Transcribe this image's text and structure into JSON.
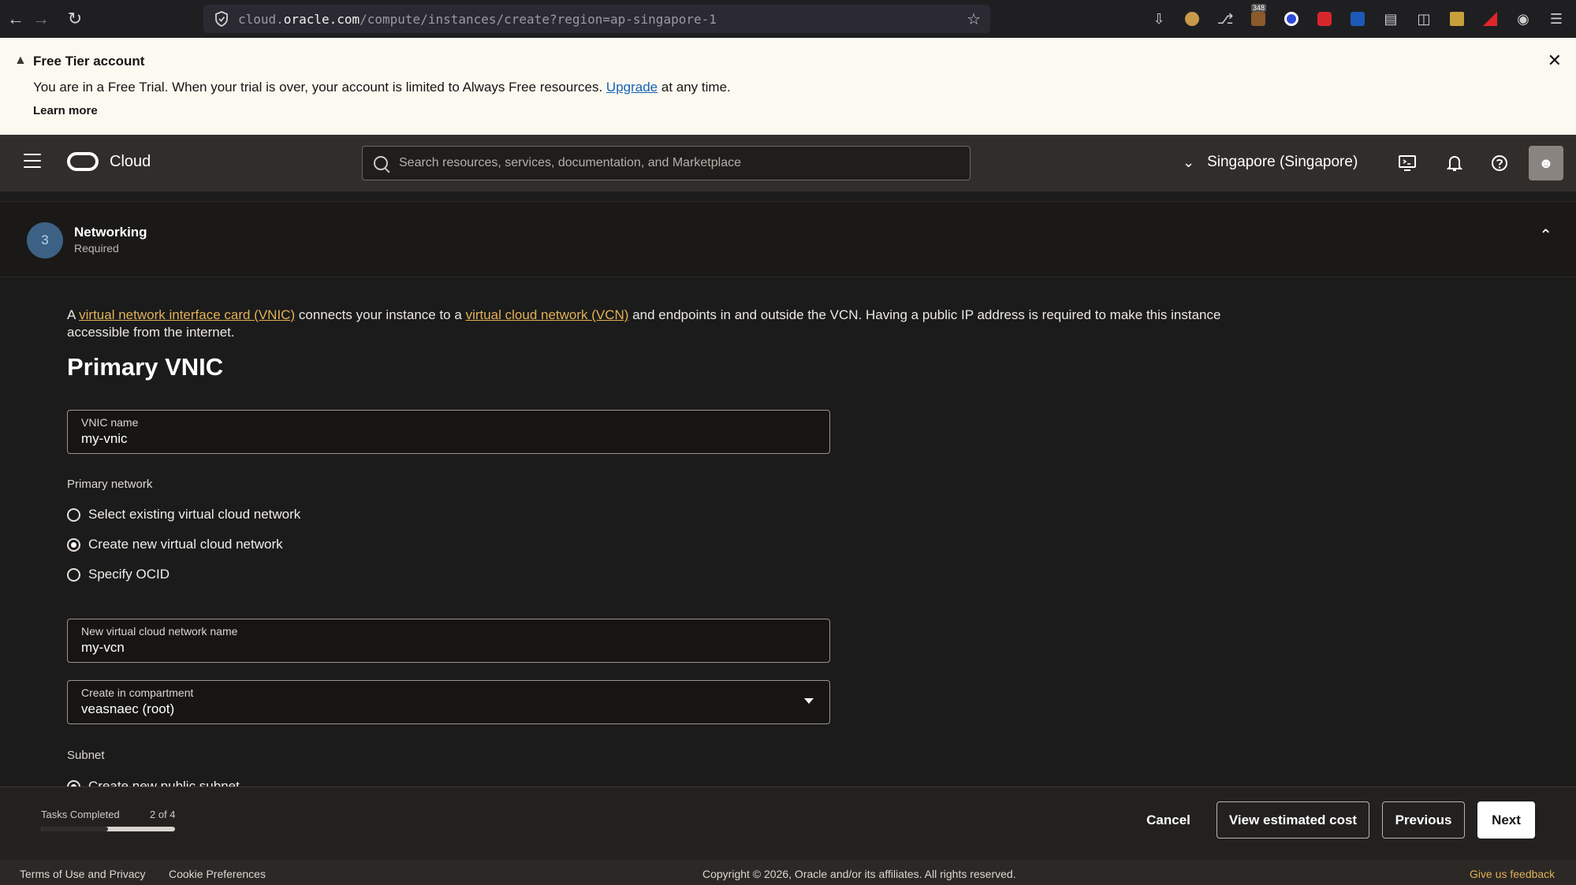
{
  "browser": {
    "url_prefix": "cloud.",
    "url_domain": "oracle.com",
    "url_path": "/compute/instances/create?region=ap-singapore-1",
    "badge_count": "348"
  },
  "banner": {
    "title": "Free Tier account",
    "text_before": "You are in a Free Trial. When your trial is over, your account is limited to Always Free resources.",
    "upgrade_link": "Upgrade",
    "text_after": "at any time.",
    "learn_more": "Learn more"
  },
  "header": {
    "logo_text": "Cloud",
    "search_placeholder": "Search resources, services, documentation, and Marketplace",
    "region": "Singapore (Singapore)"
  },
  "section": {
    "step_number": "3",
    "title": "Networking",
    "subtitle": "Required"
  },
  "content": {
    "intro_a": "A",
    "vnic_link": "virtual network interface card (VNIC)",
    "intro_mid": "connects your instance to a",
    "vcn_link": "virtual cloud network (VCN)",
    "intro_end": "and endpoints in and outside the VCN. Having a public IP address is required to make this instance accessible from the internet.",
    "heading": "Primary VNIC",
    "vnic_name_label": "VNIC name",
    "vnic_name_value": "my-vnic",
    "primary_network_label": "Primary network",
    "network_options": [
      {
        "label": "Select existing virtual cloud network",
        "checked": false
      },
      {
        "label": "Create new virtual cloud network",
        "checked": true
      },
      {
        "label": "Specify OCID",
        "checked": false
      }
    ],
    "vcn_name_label": "New virtual cloud network name",
    "vcn_name_value": "my-vcn",
    "compartment_label": "Create in compartment",
    "compartment_value": "veasnaec (root)",
    "subnet_label": "Subnet",
    "subnet_option": "Create new public subnet"
  },
  "action_bar": {
    "tasks_label": "Tasks Completed",
    "tasks_count": "2 of 4",
    "tasks_fraction": 0.5,
    "cancel": "Cancel",
    "view_cost": "View estimated cost",
    "previous": "Previous",
    "next": "Next"
  },
  "footer": {
    "terms": "Terms of Use and Privacy",
    "cookies": "Cookie Preferences",
    "copyright": "Copyright © 2026, Oracle and/or its affiliates. All rights reserved.",
    "feedback": "Give us feedback"
  },
  "colors": {
    "banner_bg": "#fcf9f1",
    "header_bg": "#312d2a",
    "link_gold": "#e3b155",
    "step_circle": "#3c6185"
  }
}
